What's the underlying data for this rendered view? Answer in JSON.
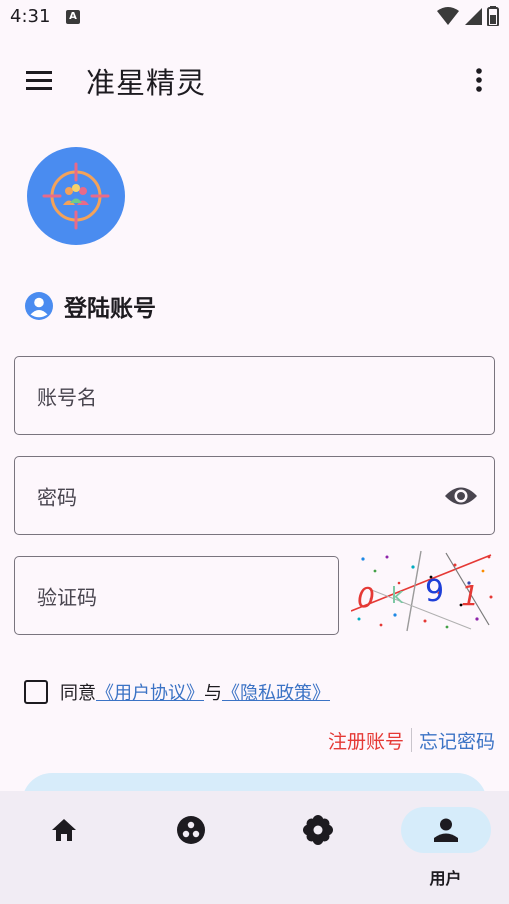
{
  "status_bar": {
    "time": "4:31",
    "notif_glyph": "A",
    "icons": [
      "wifi-icon",
      "signal-icon",
      "battery-icon"
    ]
  },
  "app_bar": {
    "title": "准星精灵",
    "menu_icon": "menu-icon",
    "more_icon": "more-vert-icon"
  },
  "login": {
    "section_title": "登陆账号",
    "account_placeholder": "账号名",
    "password_placeholder": "密码",
    "captcha_placeholder": "验证码",
    "captcha_chars": [
      "0",
      "k",
      "9",
      "1"
    ]
  },
  "agreement": {
    "agree": "同意",
    "user_agreement": "《用户协议》",
    "and": "与",
    "privacy_policy": "《隐私政策》"
  },
  "links": {
    "register": "注册账号",
    "forgot": "忘记密码"
  },
  "bottom_nav": {
    "items": [
      {
        "icon": "home-icon",
        "label": ""
      },
      {
        "icon": "dots-circle-icon",
        "label": ""
      },
      {
        "icon": "flower-icon",
        "label": ""
      },
      {
        "icon": "person-icon",
        "label": "用户"
      }
    ],
    "active_index": 3
  },
  "colors": {
    "accent_blue": "#3b73c5",
    "register_red": "#e53935",
    "logo_blue": "#4a8cf0",
    "active_pill": "#d6ecfa"
  }
}
